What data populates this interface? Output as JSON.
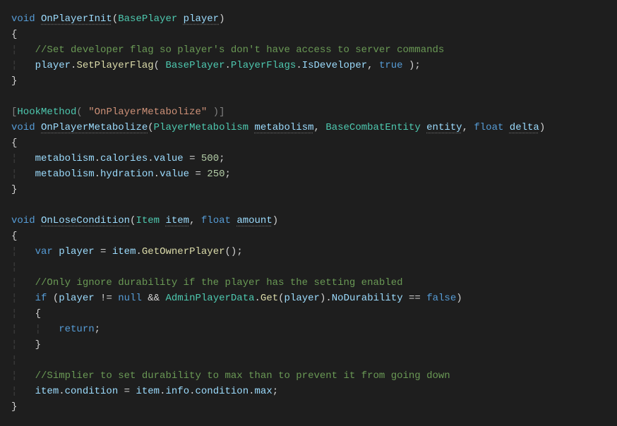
{
  "code": {
    "m1": {
      "kw_void": "void",
      "name": "OnPlayerInit",
      "ptype": "BasePlayer",
      "pname": "player",
      "comment": "//Set developer flag so player's don't have access to server commands",
      "pvar": "player",
      "call": "SetPlayerFlag",
      "arg_type": "BasePlayer",
      "arg_enum": "PlayerFlags",
      "arg_field": "IsDeveloper",
      "arg_bool": "true"
    },
    "attr": {
      "name": "HookMethod",
      "arg": "\"OnPlayerMetabolize\""
    },
    "m2": {
      "kw_void": "void",
      "name": "OnPlayerMetabolize",
      "ptype1": "PlayerMetabolism",
      "pname1": "metabolism",
      "ptype2": "BaseCombatEntity",
      "pname2": "entity",
      "ptype3": "float",
      "pname3": "delta",
      "l1_var": "metabolism",
      "l1_p1": "calories",
      "l1_p2": "value",
      "l1_val": "500",
      "l2_var": "metabolism",
      "l2_p1": "hydration",
      "l2_p2": "value",
      "l2_val": "250"
    },
    "m3": {
      "kw_void": "void",
      "name": "OnLoseCondition",
      "ptype1": "Item",
      "pname1": "item",
      "ptype2": "float",
      "pname2": "amount",
      "kw_var": "var",
      "lvar": "player",
      "rvar": "item",
      "rcall": "GetOwnerPlayer",
      "comment1": "//Only ignore durability if the player has the setting enabled",
      "kw_if": "if",
      "cond_var": "player",
      "kw_null": "null",
      "cond_type": "AdminPlayerData",
      "cond_call": "Get",
      "cond_arg": "player",
      "cond_prop": "NoDurability",
      "kw_false": "false",
      "kw_return": "return",
      "comment2": "//Simplier to set durability to max than to prevent it from going down",
      "a_var": "item",
      "a_p1": "condition",
      "b_var": "item",
      "b_p1": "info",
      "b_p2": "condition",
      "b_p3": "max"
    }
  }
}
